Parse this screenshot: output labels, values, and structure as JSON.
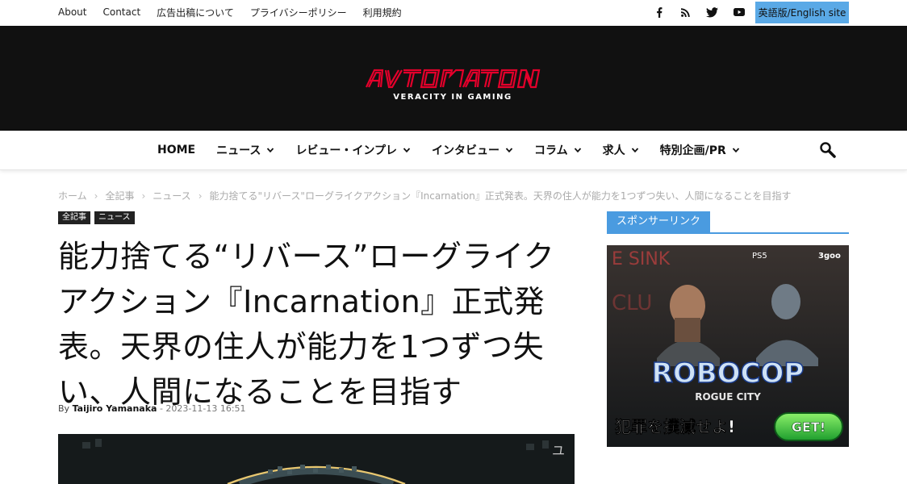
{
  "topbar": {
    "links": [
      "About",
      "Contact",
      "広告出稿について",
      "プライバシーポリシー",
      "利用規約"
    ],
    "social_icons": [
      "facebook-icon",
      "rss-icon",
      "twitter-icon",
      "youtube-icon"
    ],
    "english_site_label": "英語版/English site",
    "english_site_color": "#5aa9e6"
  },
  "header": {
    "logo_text": "AUTOMATON",
    "tagline": "VERACITY IN GAMING",
    "logo_color": "#e4002b",
    "background": "#111111"
  },
  "nav": {
    "items": [
      {
        "label": "HOME",
        "dropdown": false
      },
      {
        "label": "ニュース",
        "dropdown": true
      },
      {
        "label": "レビュー・インプレ",
        "dropdown": true
      },
      {
        "label": "インタビュー",
        "dropdown": true
      },
      {
        "label": "コラム",
        "dropdown": true
      },
      {
        "label": "求人",
        "dropdown": true
      },
      {
        "label": "特別企画/PR",
        "dropdown": true
      }
    ],
    "search_icon": "search-icon"
  },
  "breadcrumb": {
    "items": [
      "ホーム",
      "全記事",
      "ニュース",
      "能力捨てる\"リバース\"ローグライクアクション『Incarnation』正式発表。天界の住人が能力を1つずつ失い、人間になることを目指す"
    ]
  },
  "article": {
    "tags": [
      "全記事",
      "ニュース"
    ],
    "title": "能力捨てる“リバース”ローグライクアクション『Incarnation』正式発表。天界の住人が能力を1つずつ失い、人間になることを目指す",
    "by_label": "By",
    "author": "Taijiro Yamanaka",
    "date": "2023-11-13 16:51"
  },
  "sidebar": {
    "sponsor_heading": "スポンサーリンク",
    "accent_color": "#4a9be0",
    "ad": {
      "platform": "PS5",
      "publisher": "3goo",
      "game_title": "ROBOCOP",
      "subtitle": "ROGUE CITY",
      "tagline": "犯罪を撲滅せよ!",
      "cta": "GET!"
    }
  }
}
